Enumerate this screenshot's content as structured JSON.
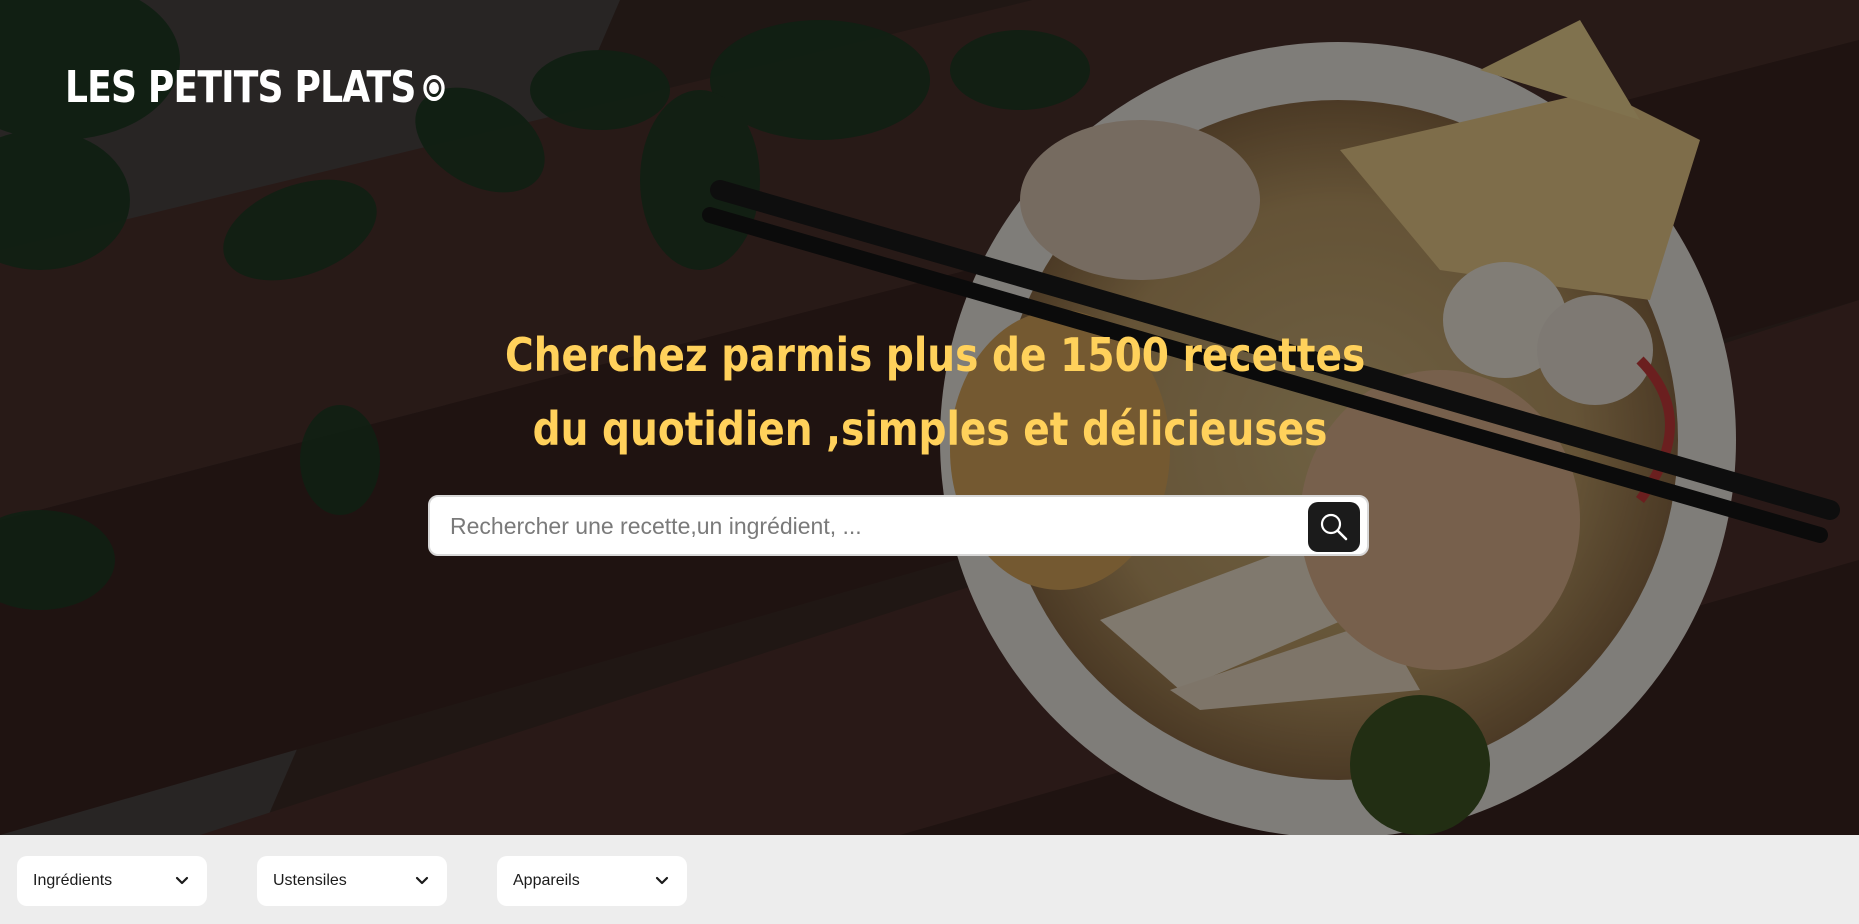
{
  "header": {
    "logo_text": "LES PETITS PLATS",
    "logo_icon": "circle-dot-icon"
  },
  "hero": {
    "headline_line1": "Cherchez parmis plus de 1500 recettes",
    "headline_line2": "du quotidien ,simples et délicieuses",
    "headline_color": "#ffd15b",
    "background_image": "bowl of noodle soup with chopsticks on wooden table"
  },
  "search": {
    "placeholder": "Rechercher une recette,un ingrédient, ...",
    "value": "",
    "button_icon": "search-icon"
  },
  "filters": [
    {
      "label": "Ingrédients",
      "icon": "chevron-down-icon"
    },
    {
      "label": "Ustensiles",
      "icon": "chevron-down-icon"
    },
    {
      "label": "Appareils",
      "icon": "chevron-down-icon"
    }
  ]
}
